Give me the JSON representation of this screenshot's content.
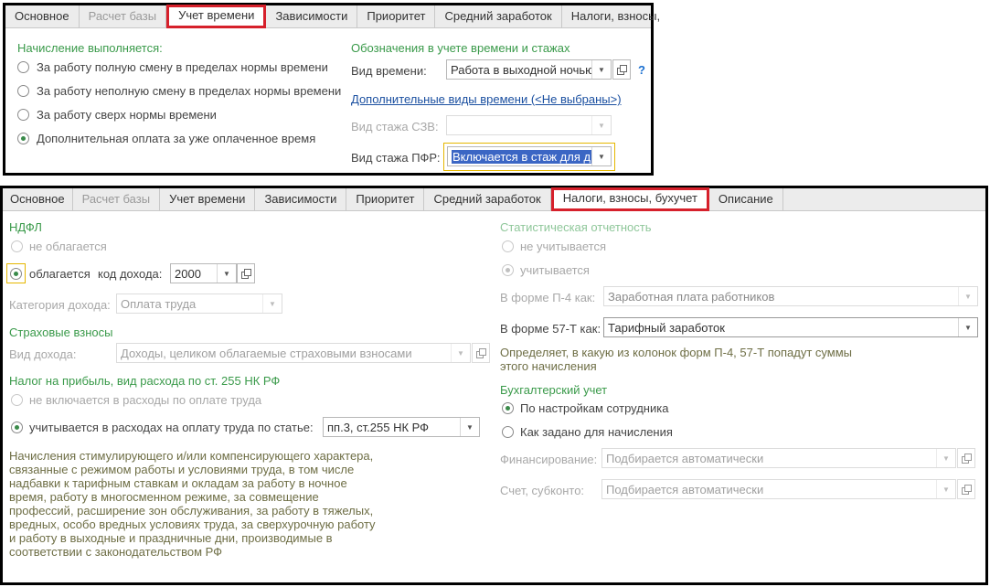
{
  "top": {
    "tabs": [
      "Основное",
      "Расчет базы",
      "Учет времени",
      "Зависимости",
      "Приоритет",
      "Средний заработок",
      "Налоги, взносы,"
    ],
    "accrual_group": "Начисление выполняется:",
    "accrual_options": [
      "За работу полную смену в пределах нормы времени",
      "За работу неполную смену в пределах нормы времени",
      "За работу сверх нормы времени",
      "Дополнительная оплата за уже оплаченное время"
    ],
    "designations_group": "Обозначения в учете времени и стажах",
    "time_type_label": "Вид времени:",
    "time_type_value": "Работа в выходной ночью",
    "help": "?",
    "extra_time_link": "Дополнительные виды времени (<Не выбраны>)",
    "szv_label": "Вид стажа СЗВ:",
    "szv_value": "",
    "pfr_label": "Вид стажа ПФР:",
    "pfr_value": "Включается в стаж для д"
  },
  "bottom": {
    "tabs": [
      "Основное",
      "Расчет базы",
      "Учет времени",
      "Зависимости",
      "Приоритет",
      "Средний заработок",
      "Налоги, взносы, бухучет",
      "Описание"
    ],
    "ndfl_group": "НДФЛ",
    "ndfl_not_taxed": "не облагается",
    "ndfl_taxed": "облагается",
    "income_code_label": "код дохода:",
    "income_code_value": "2000",
    "income_category_label": "Категория дохода:",
    "income_category_value": "Оплата труда",
    "insurance_group": "Страховые взносы",
    "income_type_label": "Вид дохода:",
    "income_type_value": "Доходы, целиком облагаемые страховыми взносами",
    "profit_tax_group": "Налог на прибыль, вид расхода по ст. 255 НК РФ",
    "profit_not_included": "не включается в расходы по оплате труда",
    "profit_included": "учитывается в расходах на оплату труда по статье:",
    "article_value": "пп.3, ст.255 НК РФ",
    "profit_note": "Начисления стимулирующего и/или компенсирующего характера, связанные с режимом работы и условиями труда, в том числе надбавки к тарифным ставкам и окладам за работу в ночное время, работу в многосменном режиме, за совмещение профессий, расширение зон обслуживания, за работу в тяжелых, вредных, особо вредных условиях труда, за сверхурочную работу и работу в выходные и праздничные дни, производимые в соответствии с законодательством РФ",
    "stats_group": "Статистическая отчетность",
    "stats_not_counted": "не учитывается",
    "stats_counted": "учитывается",
    "p4_label": "В форме П-4 как:",
    "p4_value": "Заработная плата работников",
    "f57_label": "В форме 57-Т как:",
    "f57_value": "Тарифный заработок",
    "stats_note": "Определяет, в какую из колонок форм П-4, 57-Т попадут суммы этого начисления",
    "accounting_group": "Бухгалтерский учет",
    "acc_employee": "По настройкам сотрудника",
    "acc_accrual": "Как задано для начисления",
    "financing_label": "Финансирование:",
    "financing_value": "Подбирается автоматически",
    "account_label": "Счет, субконто:",
    "account_value": "Подбирается автоматически"
  },
  "colors": {
    "accent_green": "#3a9a4a",
    "highlight_red": "#d6202b",
    "selection_blue": "#3b66c4",
    "focus_yellow": "#e5b700"
  }
}
